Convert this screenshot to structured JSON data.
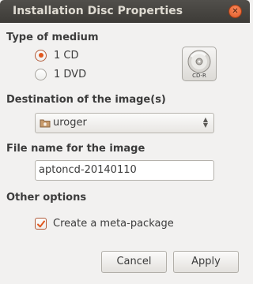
{
  "window": {
    "title": "Installation Disc Properties"
  },
  "medium": {
    "heading": "Type of medium",
    "options": [
      {
        "label": "1 CD",
        "checked": true
      },
      {
        "label": "1 DVD",
        "checked": false
      }
    ],
    "icon": "cd-r-disc-icon",
    "icon_label": "CD-R"
  },
  "destination": {
    "heading": "Destination of the image(s)",
    "selected": "uroger",
    "icon": "home-folder-icon"
  },
  "filename": {
    "heading": "File name for the image",
    "value": "aptoncd-20140110"
  },
  "other": {
    "heading": "Other options",
    "meta_package_label": "Create a meta-package",
    "meta_package_checked": true
  },
  "buttons": {
    "cancel": "Cancel",
    "apply": "Apply"
  },
  "colors": {
    "accent": "#e2571d",
    "titlebar": "#3d3b37",
    "background": "#f2f1f0"
  }
}
